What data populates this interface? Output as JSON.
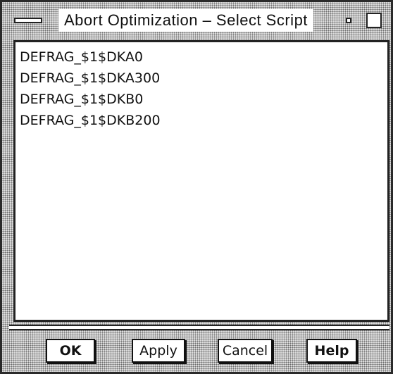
{
  "window": {
    "title": "Abort Optimization – Select Script"
  },
  "list": {
    "items": [
      "DEFRAG_$1$DKA0",
      "DEFRAG_$1$DKA300",
      "DEFRAG_$1$DKB0",
      "DEFRAG_$1$DKB200"
    ]
  },
  "buttons": {
    "ok": "OK",
    "apply": "Apply",
    "cancel": "Cancel",
    "help": "Help"
  },
  "icons": {
    "window_menu": "window-menu-icon",
    "minimize": "minimize-icon",
    "maximize": "maximize-icon"
  }
}
